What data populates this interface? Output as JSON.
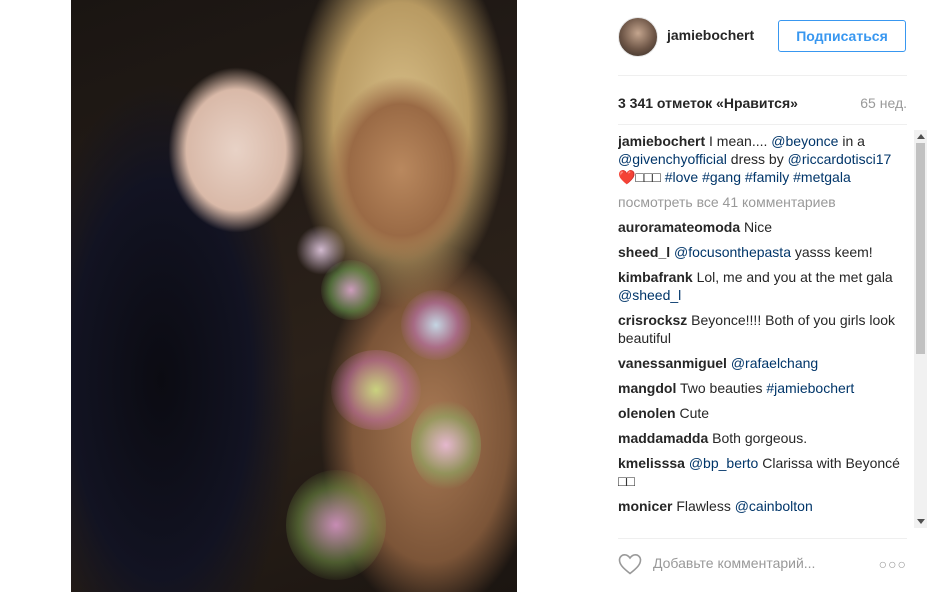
{
  "post": {
    "author": "jamiebochert",
    "follow_label": "Подписаться",
    "likes": "3 341 отметок «Нравится»",
    "age": "65 нед."
  },
  "caption": {
    "user": "jamiebochert",
    "parts": [
      {
        "text": " I mean.... ",
        "tag": false
      },
      {
        "text": "@beyonce",
        "tag": true
      },
      {
        "text": " in a ",
        "tag": false
      },
      {
        "text": "@givenchyofficial",
        "tag": true
      },
      {
        "text": " dress by ",
        "tag": false
      },
      {
        "text": "@riccardotisci17",
        "tag": true
      },
      {
        "text": " ❤️□□□ ",
        "tag": false
      },
      {
        "text": "#love",
        "tag": true
      },
      {
        "text": " ",
        "tag": false
      },
      {
        "text": "#gang",
        "tag": true
      },
      {
        "text": " ",
        "tag": false
      },
      {
        "text": "#family",
        "tag": true
      },
      {
        "text": " ",
        "tag": false
      },
      {
        "text": "#metgala",
        "tag": true
      }
    ]
  },
  "view_all": "посмотреть все 41 комментариев",
  "comments": [
    {
      "user": "auroramateomoda",
      "parts": [
        {
          "text": " Nice",
          "tag": false
        }
      ]
    },
    {
      "user": "sheed_l",
      "parts": [
        {
          "text": " ",
          "tag": false
        },
        {
          "text": "@focusonthepasta",
          "tag": true
        },
        {
          "text": " yasss keem!",
          "tag": false
        }
      ]
    },
    {
      "user": "kimbafrank",
      "parts": [
        {
          "text": " Lol, me and you at the met gala ",
          "tag": false
        },
        {
          "text": "@sheed_l",
          "tag": true
        }
      ]
    },
    {
      "user": "crisrocksz",
      "parts": [
        {
          "text": " Beyonce!!!! Both of you girls look beautiful",
          "tag": false
        }
      ]
    },
    {
      "user": "vanessanmiguel",
      "parts": [
        {
          "text": " ",
          "tag": false
        },
        {
          "text": "@rafaelchang",
          "tag": true
        }
      ]
    },
    {
      "user": "mangdol",
      "parts": [
        {
          "text": " Two beauties ",
          "tag": false
        },
        {
          "text": "#jamiebochert",
          "tag": true
        }
      ]
    },
    {
      "user": "olenolen",
      "parts": [
        {
          "text": " Cute",
          "tag": false
        }
      ]
    },
    {
      "user": "maddamadda",
      "parts": [
        {
          "text": " Both gorgeous.",
          "tag": false
        }
      ]
    },
    {
      "user": "kmelisssa",
      "parts": [
        {
          "text": " ",
          "tag": false
        },
        {
          "text": "@bp_berto",
          "tag": true
        },
        {
          "text": " Clarissa with Beyoncé □□",
          "tag": false
        }
      ]
    },
    {
      "user": "monicer",
      "parts": [
        {
          "text": " Flawless ",
          "tag": false
        },
        {
          "text": "@cainbolton",
          "tag": true
        }
      ]
    }
  ],
  "footer": {
    "add_comment_placeholder": "Добавьте комментарий...",
    "more_label": "○○○",
    "heart_icon": "heart-outline-icon"
  },
  "colors": {
    "link": "#003569",
    "follow": "#3897f0",
    "muted": "#999999"
  }
}
